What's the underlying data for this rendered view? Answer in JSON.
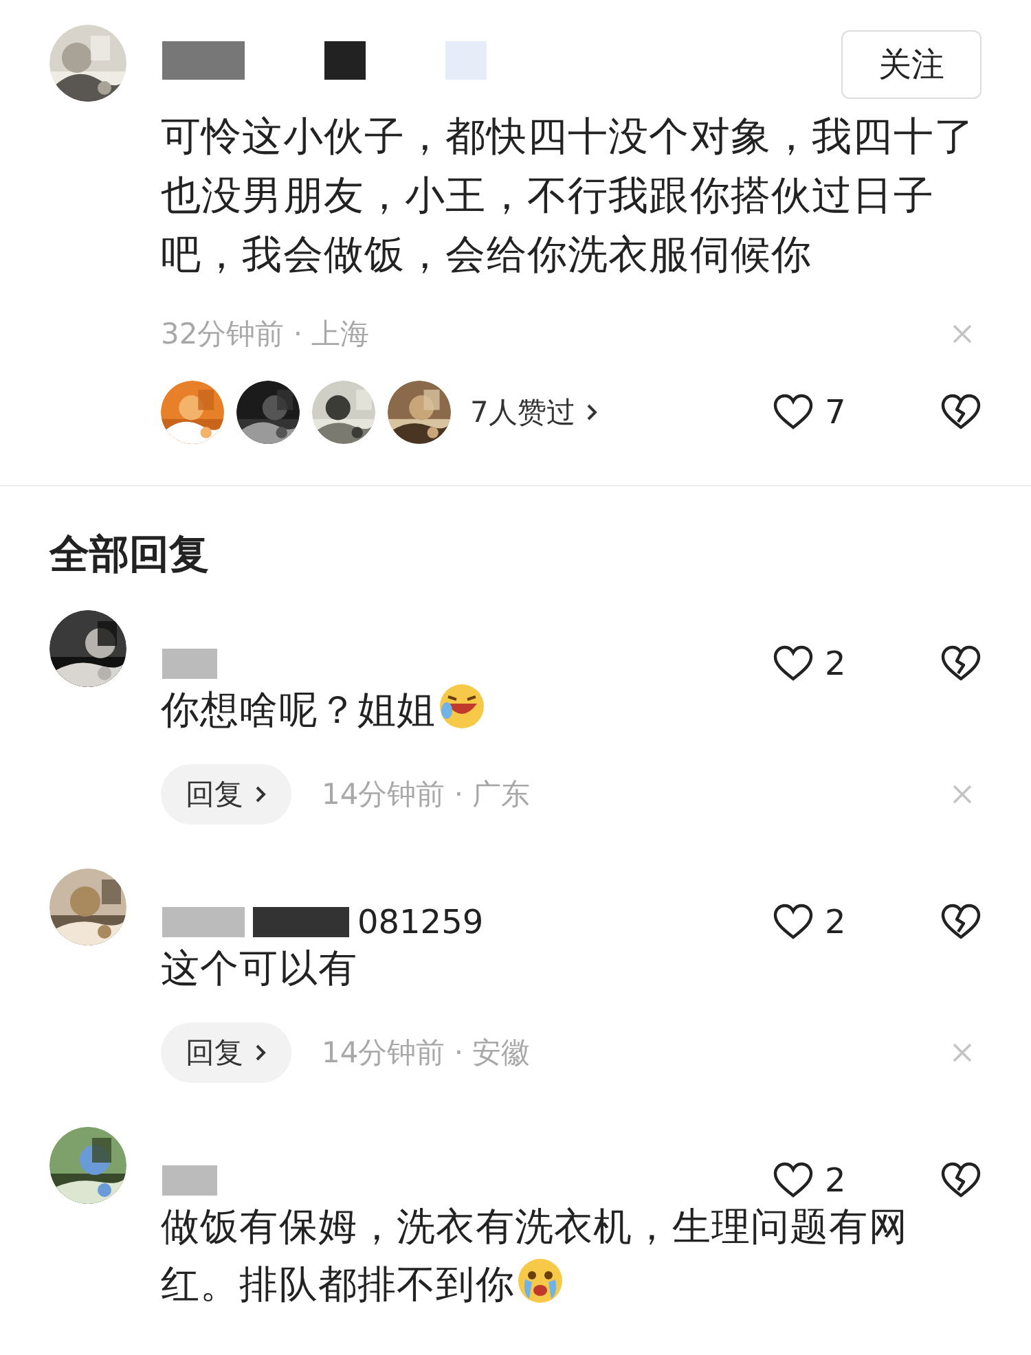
{
  "comment": {
    "follow_button": "关注",
    "text": "可怜这小伙子，都快四十没个对象，我四十了也没男朋友，小王，不行我跟你搭伙过日子吧，我会做饭，会给你洗衣服伺候你",
    "meta": "32分钟前 · 上海",
    "likers": {
      "label": "7人赞过"
    },
    "likes": "7"
  },
  "section_title": "全部回复",
  "replies": [
    {
      "likes": "2",
      "text": "你想啥呢？姐姐",
      "emoji": {
        "kind": "laughing"
      },
      "reply_button": "回复",
      "meta": "14分钟前 · 广东"
    },
    {
      "name_visible": "081259",
      "likes": "2",
      "text": "这个可以有",
      "reply_button": "回复",
      "meta": "14分钟前 · 安徽"
    },
    {
      "likes": "2",
      "text": "做饭有保姆，洗衣有洗衣机，生理问题有网红。排队都排不到你",
      "emoji": {
        "kind": "crying"
      }
    }
  ]
}
